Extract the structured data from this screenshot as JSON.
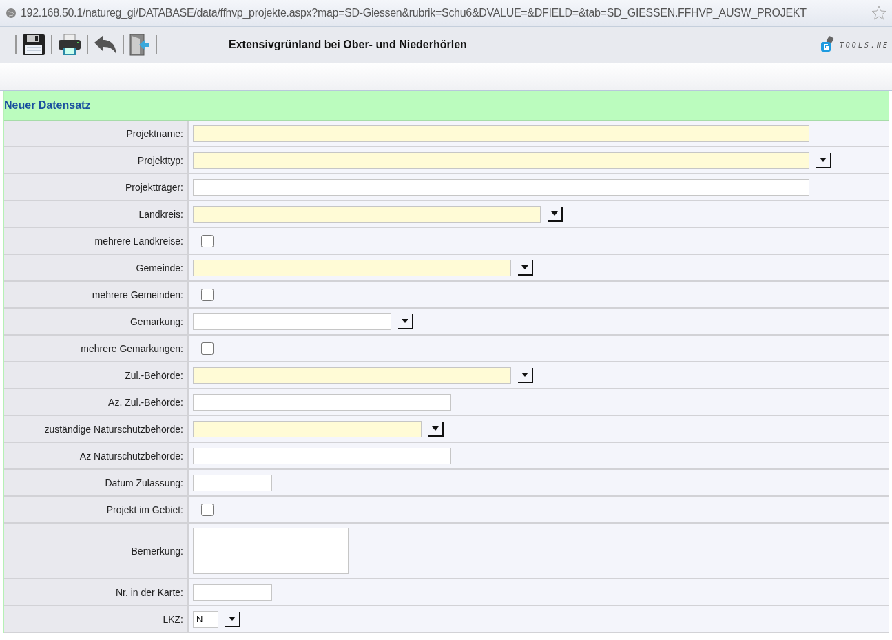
{
  "browser": {
    "url": "192.168.50.1/natureg_gi/DATABASE/data/ffhvp_projekte.aspx?map=SD-Giessen&rubrik=Schu6&DVALUE=&DFIELD=&tab=SD_GIESSEN.FFHVP_AUSW_PROJEKT"
  },
  "toolbar": {
    "title": "Extensivgrünland bei Ober- und Niederhörlen",
    "logo_text": "TOOLS.NE"
  },
  "form": {
    "header": "Neuer Datensatz",
    "fields": [
      {
        "label": "Projektname:",
        "kind": "text",
        "required": true
      },
      {
        "label": "Projekttyp:",
        "kind": "select",
        "required": true
      },
      {
        "label": "Projektträger:",
        "kind": "text",
        "required": false
      },
      {
        "label": "Landkreis:",
        "kind": "select",
        "required": true
      },
      {
        "label": "mehrere Landkreise:",
        "kind": "checkbox",
        "checked": false
      },
      {
        "label": "Gemeinde:",
        "kind": "select",
        "required": true
      },
      {
        "label": "mehrere Gemeinden:",
        "kind": "checkbox",
        "checked": false
      },
      {
        "label": "Gemarkung:",
        "kind": "select",
        "required": false
      },
      {
        "label": "mehrere Gemarkungen:",
        "kind": "checkbox",
        "checked": false
      },
      {
        "label": "Zul.-Behörde:",
        "kind": "select",
        "required": true
      },
      {
        "label": "Az. Zul.-Behörde:",
        "kind": "text",
        "required": false
      },
      {
        "label": "zuständige Naturschutzbehörde:",
        "kind": "select",
        "required": true
      },
      {
        "label": "Az Naturschutzbehörde:",
        "kind": "text",
        "required": false
      },
      {
        "label": "Datum Zulassung:",
        "kind": "text",
        "required": false
      },
      {
        "label": "Projekt im Gebiet:",
        "kind": "checkbox",
        "checked": false
      },
      {
        "label": "Bemerkung:",
        "kind": "textarea",
        "required": false
      },
      {
        "label": "Nr. in der Karte:",
        "kind": "text",
        "required": false
      },
      {
        "label": "LKZ:",
        "kind": "select",
        "required": false,
        "value": "N"
      }
    ]
  }
}
